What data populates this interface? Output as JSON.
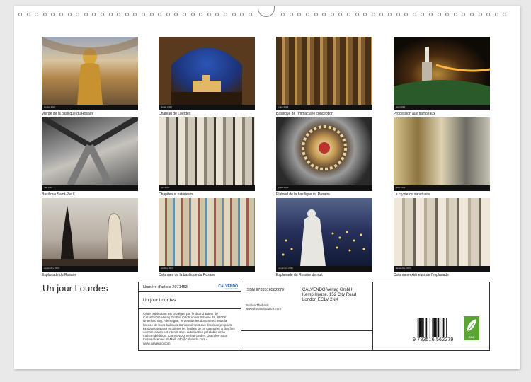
{
  "calendar": {
    "title": "Un jour Lourdes",
    "months": [
      {
        "month": "janvier 2023",
        "caption": "Vierge de la basilique du Rosaire"
      },
      {
        "month": "février 2023",
        "caption": "Château de Lourdes"
      },
      {
        "month": "mars 2023",
        "caption": "Basilique de l'Immaculée conception"
      },
      {
        "month": "avril 2023",
        "caption": "Procession aux flambeaux"
      },
      {
        "month": "mai 2023",
        "caption": "Basilique Saint-Pie X"
      },
      {
        "month": "juin 2023",
        "caption": "Chapiteaux extérieurs"
      },
      {
        "month": "juillet 2023",
        "caption": "Plafond de la basilique du Rosaire"
      },
      {
        "month": "août 2023",
        "caption": "La crypte du sanctuaire"
      },
      {
        "month": "septembre 2023",
        "caption": "Esplanade du Rosaire"
      },
      {
        "month": "octobre 2023",
        "caption": "Colonnes de la basilique du Rosaire"
      },
      {
        "month": "novembre 2023",
        "caption": "Esplanade du Rosaire de nuit"
      },
      {
        "month": "décembre 2023",
        "caption": "Colonnes extérieurs de l'esplanade"
      }
    ]
  },
  "info": {
    "article": "Numéro d'article 2071453",
    "publisher_logo": "CALVENDO",
    "publisher_sub": "www.calvendo.fr",
    "title": "Un jour Lourdes",
    "legal": "Cette publication est protégée par le droit d'auteur de CALVENDO Verlag GmbH, Ottobrunner Strasse 38, 82008 Unterhaching, Allemagne, et de tous les documents sous la licence de leurs bailleurs Conformément aux droits de propriété existants séparer et utiliser les feuilles de ce calendrier à des fins commerciales est interdit sans autorisation préalable de la maison d'édition. CALVENDO Verlag GmbH. Données sous toutes réserves. E-Mail: info@calvendo.com • www.calvendo.com",
    "isbn": "ISBN 9783516562279",
    "address_line1": "CALVENDO Verlag GmbH",
    "address_line2": "Kemp House, 152 City Road",
    "address_line3": "London EC1V 2NX",
    "author_name": "Patrice Thébault",
    "author_site": "www.thebaultpatrice.com",
    "barcode_number": "9 783516 562279",
    "eco_label": "ECO"
  }
}
